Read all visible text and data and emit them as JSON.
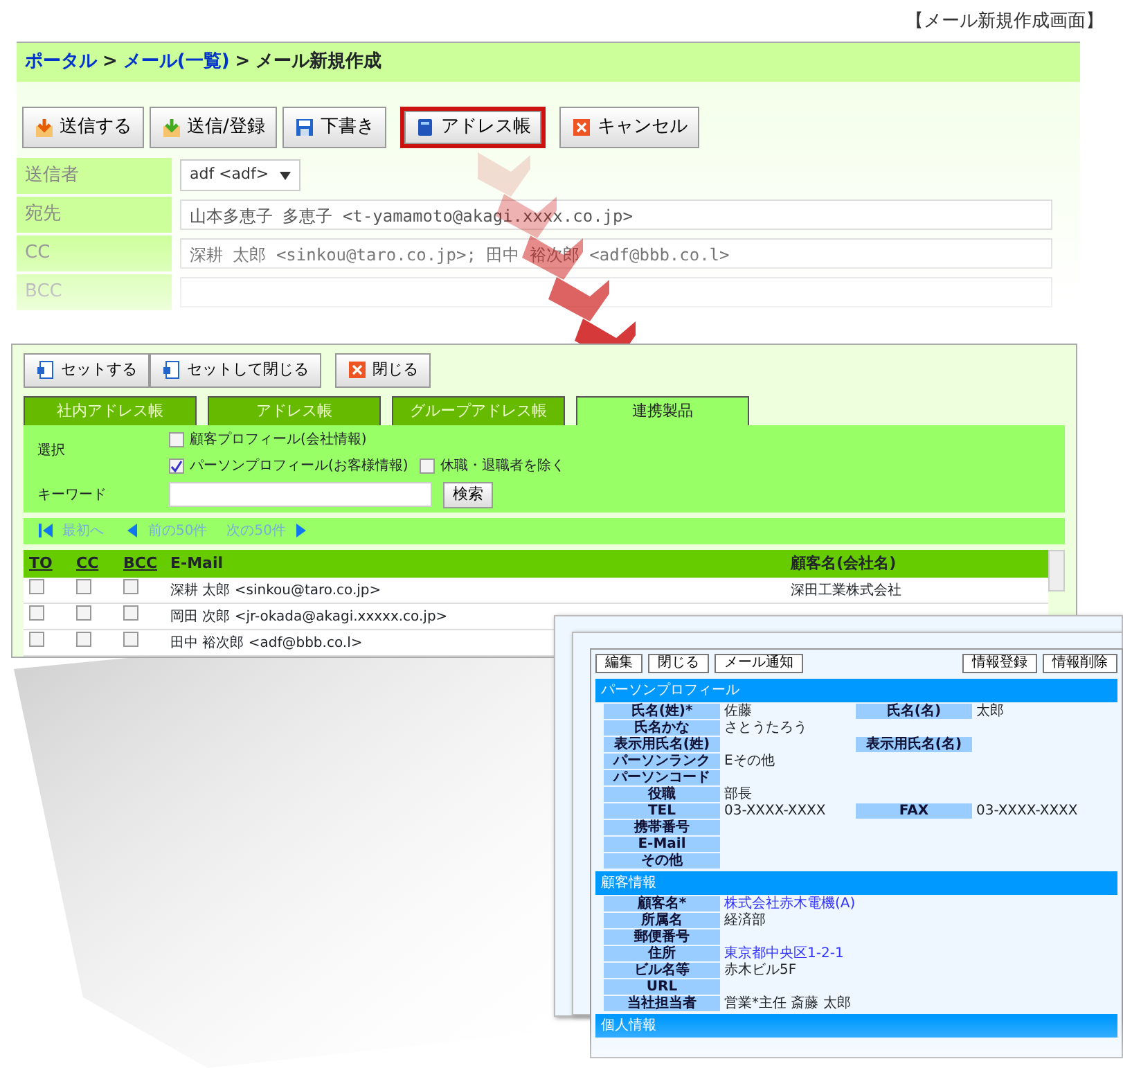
{
  "caption": "【メール新規作成画面】",
  "compose_window": {
    "breadcrumb": [
      {
        "text": "ポータル",
        "link": true
      },
      {
        "text": "メール(一覧)",
        "link": true
      },
      {
        "text": "メール新規作成",
        "link": false
      }
    ],
    "separator": ">",
    "toolbar": [
      {
        "label": "送信する",
        "highlighted": false
      },
      {
        "label": "送信/登録",
        "highlighted": false
      },
      {
        "label": "下書き",
        "highlighted": false
      },
      {
        "label": "アドレス帳",
        "highlighted": true
      },
      {
        "label": "キャンセル",
        "highlighted": false
      }
    ],
    "fields": [
      {
        "label": "送信者",
        "kind": "select",
        "value": "adf <adf>"
      },
      {
        "label": "宛先",
        "kind": "text",
        "value": "山本多恵子 多恵子 <t-yamamoto@akagi.xxxx.co.jp>"
      },
      {
        "label": "CC",
        "kind": "text",
        "value": "深耕 太郎 <sinkou@taro.co.jp>; 田中 裕次郎 <adf@bbb.co.l>"
      },
      {
        "label": "BCC",
        "kind": "text"
      }
    ]
  },
  "address_window": {
    "buttons": [
      "セットする",
      "セットして閉じる",
      "閉じる"
    ],
    "tabs": [
      {
        "label": "社内アドレス帳",
        "selected": false
      },
      {
        "label": "アドレス帳",
        "selected": false
      },
      {
        "label": "グループアドレス帳",
        "selected": false
      },
      {
        "label": "連携製品",
        "selected": true
      }
    ],
    "select_label": "選択",
    "options": [
      {
        "label": "顧客プロフィール(会社情報)",
        "checked": false
      },
      {
        "label": "パーソンプロフィール(お客様情報)",
        "checked": true
      },
      {
        "label": "休職・退職者を除く",
        "checked": false
      }
    ],
    "keyword_label": "キーワード",
    "search_button": "検索",
    "pager": [
      "最初へ",
      "前の50件",
      "次の50件"
    ],
    "columns": [
      "TO",
      "CC",
      "BCC",
      "E-Mail",
      "顧客名(会社名)"
    ],
    "rows": [
      {
        "to": false,
        "cc": false,
        "bcc": false,
        "email": "深耕 太郎 <sinkou@taro.co.jp>",
        "company": "深田工業株式会社"
      },
      {
        "to": false,
        "cc": false,
        "bcc": false,
        "email": "岡田 次郎 <jr-okada@akagi.xxxxx.co.jp>"
      },
      {
        "to": false,
        "cc": false,
        "bcc": false,
        "email": "田中 裕次郎 <adf@bbb.co.l>"
      }
    ]
  },
  "profile_window": {
    "toolbar_left": [
      "編集",
      "閉じる",
      "メール通知"
    ],
    "toolbar_right": [
      "情報登録",
      "情報削除"
    ],
    "sections": [
      {
        "title": "パーソンプロフィール",
        "rows": [
          {
            "cells": [
              {
                "label": "氏名(姓)*",
                "value": "佐藤"
              },
              {
                "label": "氏名(名)",
                "value": "太郎"
              }
            ]
          },
          {
            "cells": [
              {
                "label": "氏名かな",
                "value": "さとうたろう"
              }
            ]
          },
          {
            "cells": [
              {
                "label": "表示用氏名(姓)"
              },
              {
                "label": "表示用氏名(名)"
              }
            ]
          },
          {
            "cells": [
              {
                "label": "パーソンランク",
                "value": "Eその他"
              }
            ]
          },
          {
            "cells": [
              {
                "label": "パーソンコード"
              }
            ]
          },
          {
            "cells": [
              {
                "label": "役職",
                "value": "部長"
              }
            ]
          },
          {
            "cells": [
              {
                "label": "TEL",
                "value": "03-XXXX-XXXX"
              },
              {
                "label": "FAX",
                "value": "03-XXXX-XXXX"
              }
            ]
          },
          {
            "cells": [
              {
                "label": "携帯番号"
              }
            ]
          },
          {
            "cells": [
              {
                "label": "E-Mail"
              }
            ]
          },
          {
            "cells": [
              {
                "label": "その他"
              }
            ]
          }
        ]
      },
      {
        "title": "顧客情報",
        "rows": [
          {
            "cells": [
              {
                "label": "顧客名*",
                "value": "株式会社赤木電機(A)",
                "link": true
              }
            ]
          },
          {
            "cells": [
              {
                "label": "所属名",
                "value": "経済部"
              }
            ]
          },
          {
            "cells": [
              {
                "label": "郵便番号"
              }
            ]
          },
          {
            "cells": [
              {
                "label": "住所",
                "value": "東京都中央区1-2-1",
                "link": true
              }
            ]
          },
          {
            "cells": [
              {
                "label": "ビル名等",
                "value": "赤木ビル5F"
              }
            ]
          },
          {
            "cells": [
              {
                "label": "URL"
              }
            ]
          },
          {
            "cells": [
              {
                "label": "当社担当者",
                "value": "営業*主任 斎藤 太郎"
              }
            ]
          }
        ]
      },
      {
        "title": "個人情報"
      }
    ]
  }
}
